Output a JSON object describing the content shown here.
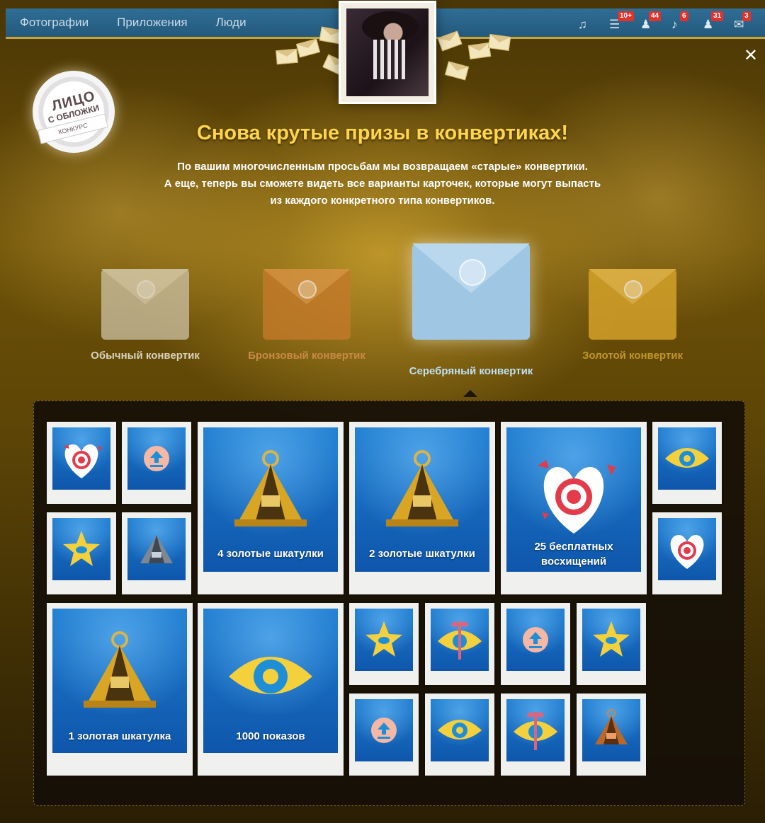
{
  "nav": {
    "items": [
      "Фотографии",
      "Приложения",
      "Люди"
    ]
  },
  "toolbar": {
    "icons": [
      {
        "name": "music-icon",
        "badge": ""
      },
      {
        "name": "friends-list-icon",
        "badge": "10+"
      },
      {
        "name": "guests-icon",
        "badge": "44"
      },
      {
        "name": "notifications-icon",
        "badge": "6"
      },
      {
        "name": "friend-requests-icon",
        "badge": "31"
      },
      {
        "name": "messages-icon",
        "badge": "3"
      }
    ]
  },
  "logo": {
    "line1": "ЛИЦО",
    "line2": "С ОБЛОЖКИ",
    "ribbon": "КОНКУРС"
  },
  "headline": "Снова крутые призы в конвертиках!",
  "subtext": [
    "По вашим многочисленным просьбам мы возвращаем «старые» конвертики.",
    "А еще, теперь вы сможете видеть все варианты карточек, которые могут выпасть",
    "из каждого конкретного типа конвертиков."
  ],
  "envelopes": [
    {
      "label": "Обычный конвертик",
      "color": "#c9bda0",
      "active": false
    },
    {
      "label": "Бронзовый конвертик",
      "color": "#c47a2a",
      "active": false
    },
    {
      "label": "Серебряный конвертик",
      "color": "#9fc7e4",
      "active": true
    },
    {
      "label": "Золотой конвертик",
      "color": "#d4a12a",
      "active": false
    }
  ],
  "cards": {
    "large": [
      {
        "caption": "4 золотые шкатулки",
        "icon": "gold-casket-icon"
      },
      {
        "caption": "2 золотые шкатулки",
        "icon": "gold-casket-icon"
      },
      {
        "caption": "25 бесплатных восхищений",
        "icon": "heart-target-icon"
      },
      {
        "caption": "1 золотая шкатулка",
        "icon": "gold-casket-icon"
      },
      {
        "caption": "1000 показов",
        "icon": "eye-icon"
      }
    ]
  },
  "colors": {
    "accent": "#ffd54a",
    "active_label": "#bfe0f2",
    "topbar": "#2b6a92"
  }
}
